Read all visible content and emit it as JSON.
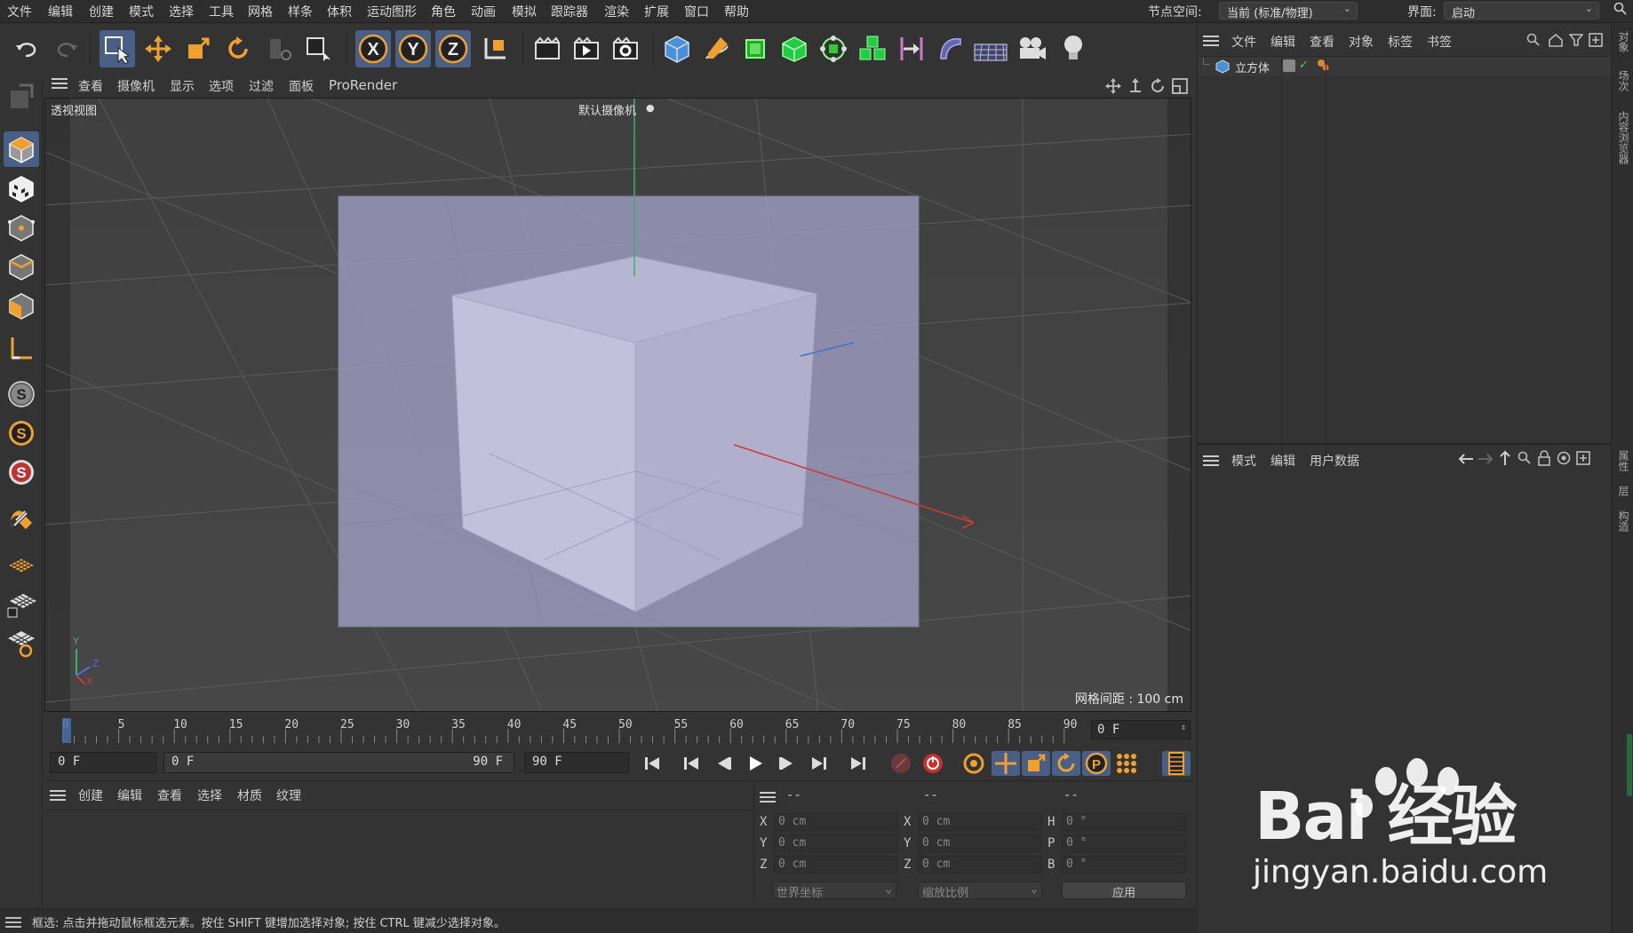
{
  "menubar": {
    "items": [
      "文件",
      "编辑",
      "创建",
      "模式",
      "选择",
      "工具",
      "网格",
      "样条",
      "体积",
      "运动图形",
      "角色",
      "动画",
      "模拟",
      "跟踪器",
      "渲染",
      "扩展",
      "窗口",
      "帮助"
    ],
    "node_space_label": "节点空间:",
    "node_space_value": "当前 (标准/物理)",
    "interface_label": "界面:",
    "interface_value": "启动"
  },
  "toolbar": {
    "icons": [
      "undo-icon",
      "redo-icon",
      "live-selection-icon",
      "move-icon",
      "scale-icon",
      "rotate-icon",
      "recent-tool-icon",
      "selection-filter-icon",
      "x-axis-lock-icon",
      "y-axis-lock-icon",
      "z-axis-lock-icon",
      "coordinate-system-icon",
      "render-region-icon",
      "render-view-icon",
      "render-settings-icon",
      "cube-icon",
      "pen-icon",
      "subdivision-icon",
      "extrude-icon",
      "cloner-icon",
      "array-icon",
      "symmetry-icon",
      "deformer-icon",
      "floor-icon",
      "camera-icon",
      "light-icon"
    ],
    "axis_x": "X",
    "axis_y": "Y",
    "axis_z": "Z"
  },
  "left_toolbar": {
    "icons": [
      "make-editable-icon",
      "model-mode-icon",
      "texture-mode-icon",
      "point-mode-icon",
      "edge-mode-icon",
      "polygon-mode-icon",
      "axis-mode-icon",
      "snap-icon",
      "snap-settings-icon",
      "quantize-icon",
      "magnet-icon",
      "workplane-icon",
      "locked-workplane-icon",
      "workplane-settings-icon"
    ]
  },
  "viewport": {
    "menu": [
      "查看",
      "摄像机",
      "显示",
      "选项",
      "过滤",
      "面板",
      "ProRender"
    ],
    "title": "透视视图",
    "camera": "默认摄像机",
    "grid_spacing": "网格间距 : 100 cm",
    "axis_y": "Y",
    "axis_z": "Z",
    "axis_x": "X"
  },
  "timeline": {
    "ticks": [
      "0",
      "5",
      "10",
      "15",
      "20",
      "25",
      "30",
      "35",
      "40",
      "45",
      "50",
      "55",
      "60",
      "65",
      "70",
      "75",
      "80",
      "85",
      "90"
    ],
    "current_frame": "0 F"
  },
  "transport": {
    "start_frame": "0 F",
    "range_start": "0 F",
    "range_end": "90 F",
    "end_frame": "90 F"
  },
  "material_panel": {
    "menu": [
      "创建",
      "编辑",
      "查看",
      "选择",
      "材质",
      "纹理"
    ]
  },
  "coord_panel": {
    "headers": [
      "--",
      "--",
      "--"
    ],
    "labels_pos": [
      "X",
      "Y",
      "Z"
    ],
    "labels_size": [
      "X",
      "Y",
      "Z"
    ],
    "labels_rot": [
      "H",
      "P",
      "B"
    ],
    "pos_values": [
      "0 cm",
      "0 cm",
      "0 cm"
    ],
    "size_values": [
      "0 cm",
      "0 cm",
      "0 cm"
    ],
    "rot_values": [
      "0 °",
      "0 °",
      "0 °"
    ],
    "coord_mode": "世界坐标",
    "scale_mode": "缩放比例",
    "apply": "应用"
  },
  "statusbar": {
    "text": "框选: 点击并拖动鼠标框选元素。按住 SHIFT 键增加选择对象; 按住 CTRL 键减少选择对象。"
  },
  "object_panel": {
    "menu": [
      "文件",
      "编辑",
      "查看",
      "对象",
      "标签",
      "书签"
    ],
    "object_name": "立方体"
  },
  "attribute_panel": {
    "menu": [
      "模式",
      "编辑",
      "用户数据"
    ]
  },
  "side_tabs": [
    "对象",
    "场次",
    "内容浏览器",
    "属性",
    "层",
    "构造"
  ],
  "watermark": {
    "logo": "Bai 经验",
    "url": "jingyan.baidu.com"
  },
  "colors": {
    "accent": "#4a5f86",
    "orange": "#f0a030",
    "panel_bg": "#333333",
    "viewport_bg": "#3c3c3c"
  }
}
